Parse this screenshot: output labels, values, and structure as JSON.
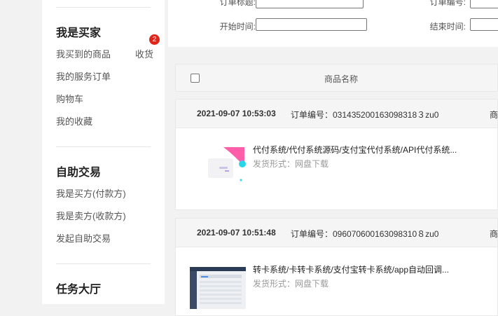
{
  "sidebar": {
    "buyer_title": "我是买家",
    "buyer_items": [
      "我买到的商品",
      "我的服务订单",
      "购物车",
      "我的收藏"
    ],
    "receive_label": "收货",
    "receive_count": "2",
    "trade_title": "自助交易",
    "trade_items": [
      "我是买方(付款方)",
      "我是卖方(收款方)",
      "发起自助交易"
    ],
    "task_title": "任务大厅"
  },
  "filters": {
    "order_title_label": "订单标题:",
    "order_no_label": "订单编号:",
    "start_time_label": "开始时间:",
    "end_time_label": "结束时间:"
  },
  "table": {
    "product_name_header": "商品名称"
  },
  "orders": [
    {
      "date": "2021-09-07 10:53:03",
      "order_no": "订单编号：031435200163098318３zu0",
      "right_text": "商",
      "product_title": "代付系统/代付系统源码/支付宝代付系统/API代付系统...",
      "shipping": "发货形式：网盘下载"
    },
    {
      "date": "2021-09-07 10:51:48",
      "order_no": "订单编号：096070600163098310８zu0",
      "right_text": "商",
      "product_title": "转卡系统/卡转卡系统/支付宝转卡系统/app自动回调...",
      "shipping": "发货形式：网盘下载"
    }
  ],
  "colors": {
    "badge": "#e1251b",
    "accent_pink": "#ff5fa8",
    "accent_cyan": "#27d6e8"
  }
}
